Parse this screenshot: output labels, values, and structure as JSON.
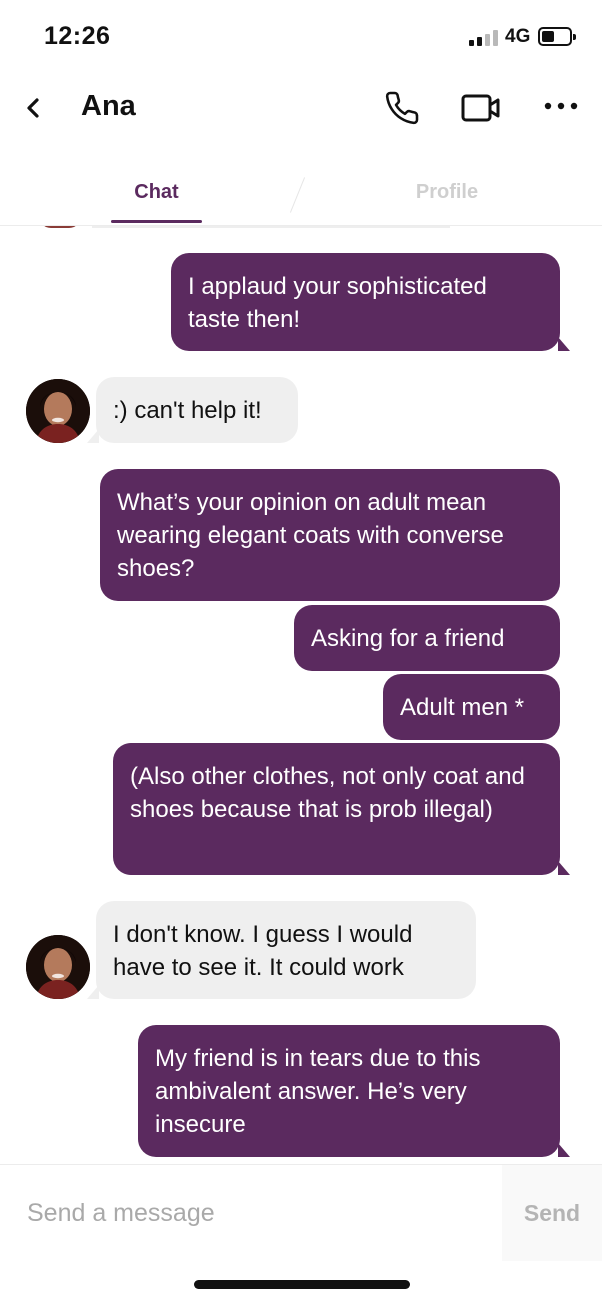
{
  "status_bar": {
    "time": "12:26",
    "network": "4G",
    "signal_bars_active": 2,
    "signal_bars_total": 4,
    "battery_level": 0.4
  },
  "header": {
    "back_icon": "chevron-left-icon",
    "contact_name": "Ana",
    "call_icon": "phone-icon",
    "video_icon": "video-camera-icon",
    "more_icon": "more-horizontal-icon"
  },
  "tabs": {
    "active": "Chat",
    "items": [
      {
        "label": "Chat"
      },
      {
        "label": "Profile"
      }
    ]
  },
  "messages": [
    {
      "direction": "outgoing",
      "text": "I applaud your sophisticated taste then!"
    },
    {
      "direction": "incoming",
      "text": ":) can't help it!"
    },
    {
      "direction": "outgoing",
      "text": "What’s your opinion on adult mean wearing elegant coats with converse shoes?"
    },
    {
      "direction": "outgoing",
      "text": "Asking for a friend"
    },
    {
      "direction": "outgoing",
      "text": "Adult men *"
    },
    {
      "direction": "outgoing",
      "text": "(Also other clothes, not only coat and shoes because that is prob illegal)"
    },
    {
      "direction": "incoming",
      "text": "I don't know. I guess I would have to see it. It could work"
    },
    {
      "direction": "outgoing",
      "text": "My friend is in tears due to this ambivalent answer. He’s very insecure"
    }
  ],
  "composer": {
    "placeholder": "Send a message",
    "value": "",
    "send_label": "Send"
  },
  "colors": {
    "accent": "#5b2a5f",
    "incoming_bubble": "#efefef",
    "inactive_tab": "#cfcfcf",
    "placeholder": "#a9a9a9"
  }
}
